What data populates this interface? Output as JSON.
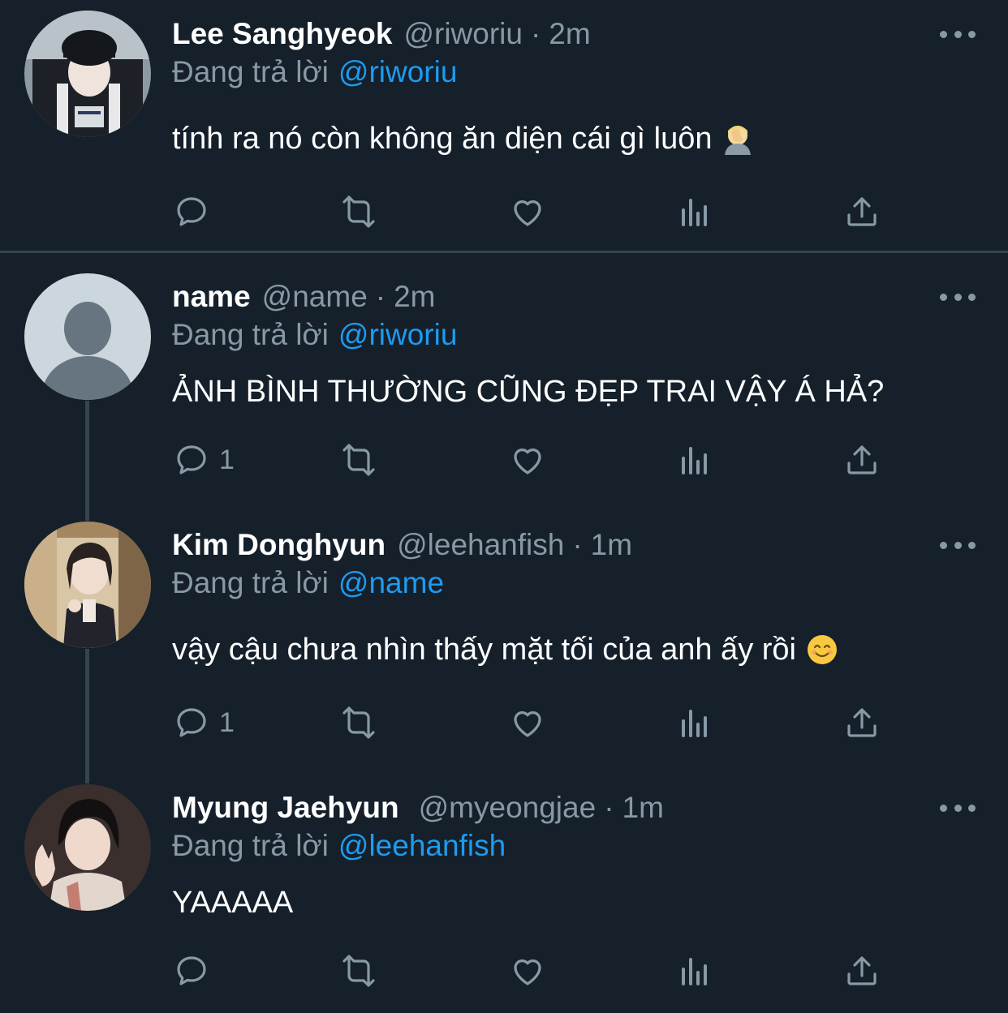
{
  "tweets": [
    {
      "name": "Lee Sanghyeok",
      "handle": "@riworiu",
      "dot": "·",
      "time": "2m",
      "reply_prefix": "Đang trả lời",
      "reply_to": "@riworiu",
      "text": "tính ra nó còn không ăn diện cái gì luôn",
      "emoji": "face-palm-emoji",
      "reply_count": "",
      "icons": [
        "reply-icon",
        "retweet-icon",
        "like-icon",
        "analytics-icon",
        "share-icon"
      ]
    },
    {
      "name": "name",
      "handle": "@name",
      "dot": "·",
      "time": "2m",
      "reply_prefix": "Đang trả lời",
      "reply_to": "@riworiu",
      "text": "ẢNH BÌNH THƯỜNG CŨNG ĐẸP TRAI VẬY Á HẢ?",
      "reply_count": "1"
    },
    {
      "name": "Kim Donghyun",
      "handle": "@leehanfish",
      "dot": "·",
      "time": "1m",
      "reply_prefix": "Đang trả lời",
      "reply_to": "@name",
      "text": "vậy cậu chưa nhìn thấy mặt tối của anh ấy rồi",
      "emoji": "smiling-face-emoji",
      "reply_count": "1"
    },
    {
      "name": "Myung Jaehyun",
      "handle": "@myeongjae",
      "dot": "·",
      "time": "1m",
      "reply_prefix": "Đang trả lời",
      "reply_to": "@leehanfish",
      "text": "YAAAAA",
      "reply_count": ""
    }
  ],
  "colors": {
    "background": "#15202b",
    "secondary_text": "#8899a6",
    "link": "#1d9bf0",
    "divider": "#38444d"
  }
}
